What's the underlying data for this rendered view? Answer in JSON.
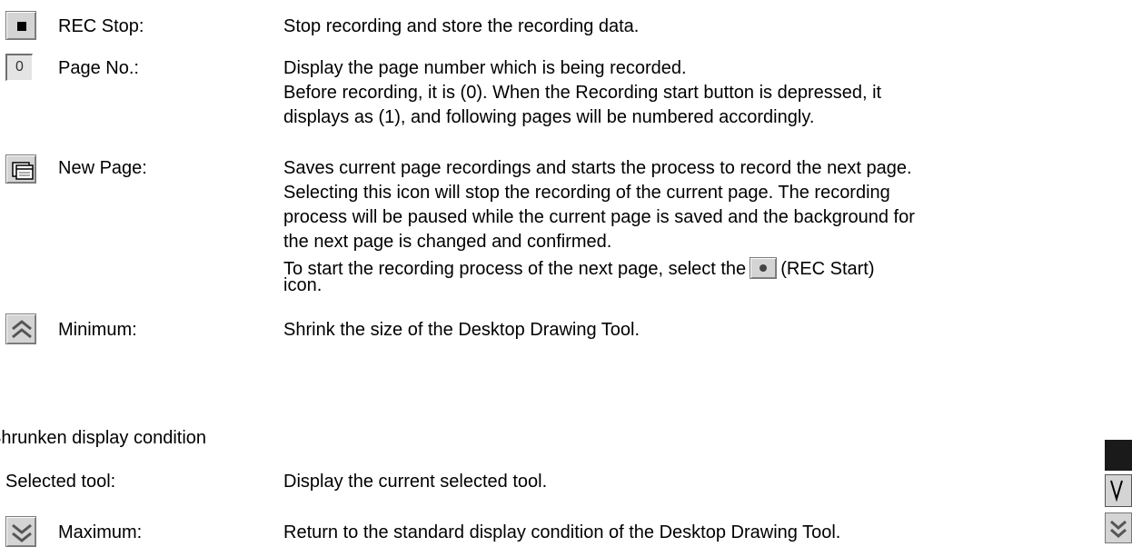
{
  "rows": [
    {
      "label": "REC Stop:",
      "icon": "stop-icon",
      "lines": [
        "Stop recording and store the recording data."
      ]
    },
    {
      "label": "Page No.:",
      "icon": "page-number-display",
      "value": "0",
      "lines": [
        "Display the page number which is being recorded.",
        "Before recording, it is (0). When the Recording start button is depressed, it",
        "displays as (1), and following pages will be numbered accordingly."
      ]
    },
    {
      "label": "New Page:",
      "icon": "new-page-icon",
      "lines": [
        "Saves current page recordings and starts the process to record the next page.",
        "Selecting this icon will stop the recording of the current page. The recording",
        "process will be paused while the current page is saved and the background for",
        "the next page is changed and confirmed."
      ],
      "last_line_before": "To start the recording process of the next page, select the",
      "last_line_after": "(REC Start)",
      "last_line_wrap": "icon.",
      "inline_icon": "rec-start-icon"
    },
    {
      "label": "Minimum:",
      "icon": "minimize-chevrons-up-icon",
      "lines": [
        "Shrink the size of the Desktop Drawing Tool."
      ]
    }
  ],
  "section_heading": "Shrunken display condition",
  "shrunken_rows": [
    {
      "label": "Selected tool:",
      "lines": [
        "Display the current selected tool."
      ]
    },
    {
      "label": "Maximum:",
      "icon": "maximize-chevrons-down-icon",
      "lines": [
        "Return to the standard display condition of the Desktop Drawing Tool."
      ]
    }
  ]
}
